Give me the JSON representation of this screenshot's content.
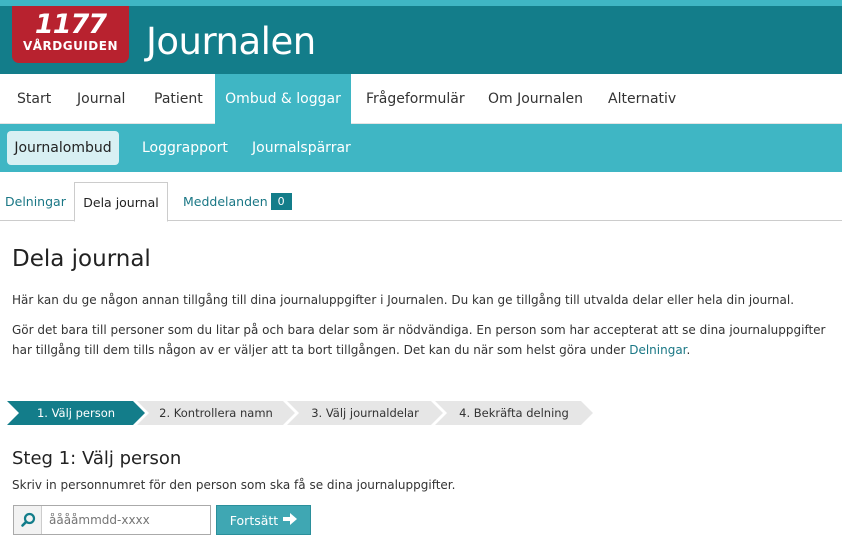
{
  "header": {
    "logo_number": "1177",
    "logo_subtitle": "VÅRDGUIDEN",
    "app_title": "Journalen"
  },
  "main_nav": {
    "items": [
      "Start",
      "Journal",
      "Patient",
      "Ombud & loggar",
      "Frågeformulär",
      "Om Journalen",
      "Alternativ"
    ],
    "active": "Ombud & loggar"
  },
  "sub_nav": {
    "items": [
      "Journalombud",
      "Loggrapport",
      "Journalspärrar"
    ],
    "active": "Journalombud"
  },
  "tabs": {
    "items": [
      "Delningar",
      "Dela journal",
      "Meddelanden"
    ],
    "active": "Dela journal",
    "messages_count": "0"
  },
  "content": {
    "title": "Dela journal",
    "intro": "Här kan du ge någon annan tillgång till dina journaluppgifter i Journalen. Du kan ge tillgång till utvalda delar eller hela din journal.",
    "info_line1": "Gör det bara till personer som du litar på och bara delar som är nödvändiga. En person som har accepterat att se dina journaluppgifter",
    "info_line2_pre": "har tillgång till dem tills någon av er väljer att ta bort tillgången. Det kan du när som helst göra under ",
    "info_link": "Delningar",
    "info_line2_post": "."
  },
  "steps": {
    "items": [
      "1. Välj person",
      "2. Kontrollera namn",
      "3. Välj journaldelar",
      "4. Bekräfta delning"
    ],
    "active_index": 0
  },
  "step1": {
    "title": "Steg 1: Välj person",
    "instruction": "Skriv in personnumret för den person som ska få se dina journaluppgifter.",
    "input_placeholder": "ååååmmdd-xxxx",
    "button_label": "Fortsätt"
  },
  "icons": {
    "search": "search-icon",
    "arrow": "arrow-right-icon"
  },
  "colors": {
    "header_teal": "#137d8a",
    "nav_teal": "#3fb6c4",
    "logo_red": "#b8222f",
    "link_teal": "#1a7785"
  }
}
